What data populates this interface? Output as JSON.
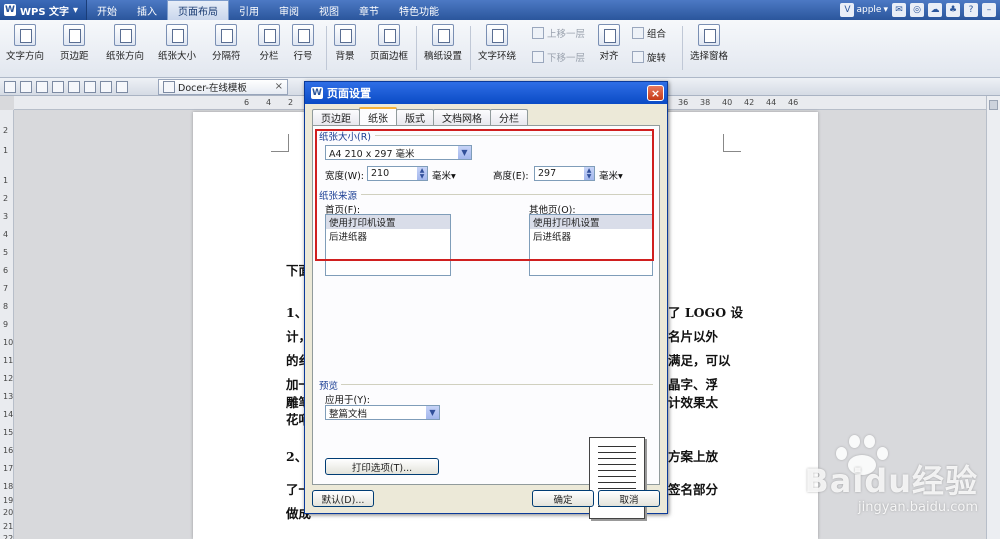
{
  "app": {
    "name": "WPS 文字",
    "logo_letter": "W"
  },
  "menu": [
    {
      "label": "开始",
      "active": false
    },
    {
      "label": "插入",
      "active": false
    },
    {
      "label": "页面布局",
      "active": true
    },
    {
      "label": "引用",
      "active": false
    },
    {
      "label": "审阅",
      "active": false
    },
    {
      "label": "视图",
      "active": false
    },
    {
      "label": "章节",
      "active": false
    },
    {
      "label": "特色功能",
      "active": false
    }
  ],
  "user": {
    "name": "apple",
    "help": "?"
  },
  "ribbon": {
    "text_direction": "文字方向",
    "margins": "页边距",
    "orientation": "纸张方向",
    "size": "纸张大小",
    "separator": "分隔符",
    "columns": "分栏",
    "line_number": "行号",
    "background": "背景",
    "page_border": "页面边框",
    "draft_paper": "稿纸设置",
    "wrap_text": "文字环绕",
    "bring_forward": "上移一层",
    "send_backward": "下移一层",
    "align": "对齐",
    "group": "组合",
    "rotate": "旋转",
    "selection_pane": "选择窗格"
  },
  "doc_tab": {
    "label": "Docer-在线模板"
  },
  "hruler_ticks": [
    "6",
    "4",
    "2",
    "2",
    "36",
    "38",
    "40",
    "42",
    "44",
    "46"
  ],
  "vruler_ticks": [
    "2",
    "1",
    "1",
    "2",
    "3",
    "4",
    "5",
    "6",
    "7",
    "8",
    "9",
    "10",
    "11",
    "12",
    "13",
    "14",
    "15",
    "16",
    "17",
    "18",
    "19",
    "20",
    "21",
    "22"
  ],
  "document": {
    "left_lines": [
      "下面",
      "1、",
      "计，",
      "的纟",
      "加一",
      "雕笔",
      "花哨",
      "2、",
      "了一",
      "做成"
    ],
    "right_lines": [
      "了 LOGO 设",
      "名片以外",
      "满足，可以",
      "晶字、浮",
      "计效果太",
      "方案上放",
      "签名部分"
    ]
  },
  "dialog": {
    "title": "页面设置",
    "close": "×",
    "tabs": [
      {
        "label": "页边距",
        "active": false
      },
      {
        "label": "纸张",
        "active": true
      },
      {
        "label": "版式",
        "active": false
      },
      {
        "label": "文档网格",
        "active": false
      },
      {
        "label": "分栏",
        "active": false
      }
    ],
    "paper_size": {
      "group_label": "纸张大小(R)",
      "selected": "A4 210 x 297 毫米",
      "width_label": "宽度(W):",
      "width_value": "210",
      "width_unit": "毫米▾",
      "height_label": "高度(E):",
      "height_value": "297",
      "height_unit": "毫米▾"
    },
    "paper_source": {
      "group_label": "纸张来源",
      "first_page_label": "首页(F):",
      "first_page_items": [
        "使用打印机设置",
        "后进纸器"
      ],
      "other_pages_label": "其他页(O):",
      "other_pages_items": [
        "使用打印机设置",
        "后进纸器"
      ]
    },
    "preview": {
      "group_label": "预览",
      "apply_label": "应用于(Y):",
      "apply_value": "整篇文档"
    },
    "print_options": "打印选项(T)...",
    "default_button": "默认(D)...",
    "ok_button": "确定",
    "cancel_button": "取消"
  },
  "watermark": {
    "main": "Baidu经验",
    "url": "jingyan.baidu.com"
  }
}
